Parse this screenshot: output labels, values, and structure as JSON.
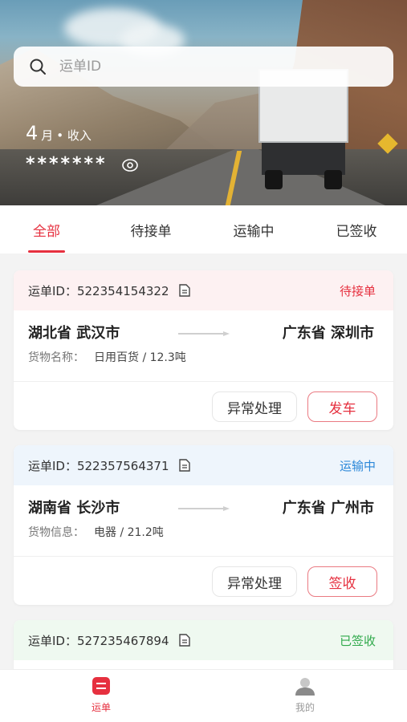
{
  "search": {
    "placeholder": "运单ID"
  },
  "income": {
    "month": "4",
    "month_unit": "月",
    "label": "• 收入",
    "amount": "*******"
  },
  "tabs": [
    {
      "label": "全部",
      "active": true
    },
    {
      "label": "待接单",
      "active": false
    },
    {
      "label": "运输中",
      "active": false
    },
    {
      "label": "已签收",
      "active": false
    }
  ],
  "orders": [
    {
      "id_label": "运单ID：522354154322",
      "status": "待接单",
      "status_color": "#e6303f",
      "head_bg": "#fdf1f2",
      "from": "湖北省 武汉市",
      "to": "广东省 深圳市",
      "goods_key": "货物名称：",
      "goods_value": "日用百货 / 12.3吨",
      "btn_plain": "异常处理",
      "btn_primary": "发车"
    },
    {
      "id_label": "运单ID：522357564371",
      "status": "运输中",
      "status_color": "#2a87d8",
      "head_bg": "#eef5fc",
      "from": "湖南省 长沙市",
      "to": "广东省 广州市",
      "goods_key": "货物信息：",
      "goods_value": "电器 / 21.2吨",
      "btn_plain": "异常处理",
      "btn_primary": "签收"
    },
    {
      "id_label": "运单ID：527235467894",
      "status": "已签收",
      "status_color": "#2fa94a",
      "head_bg": "#eff9f0"
    }
  ],
  "nav": [
    {
      "label": "运单",
      "icon": "waybill-icon",
      "active": true,
      "color": "#e6303f"
    },
    {
      "label": "我的",
      "icon": "user-icon",
      "active": false,
      "color": "#999999"
    }
  ],
  "colors": {
    "accent": "#e6303f"
  }
}
